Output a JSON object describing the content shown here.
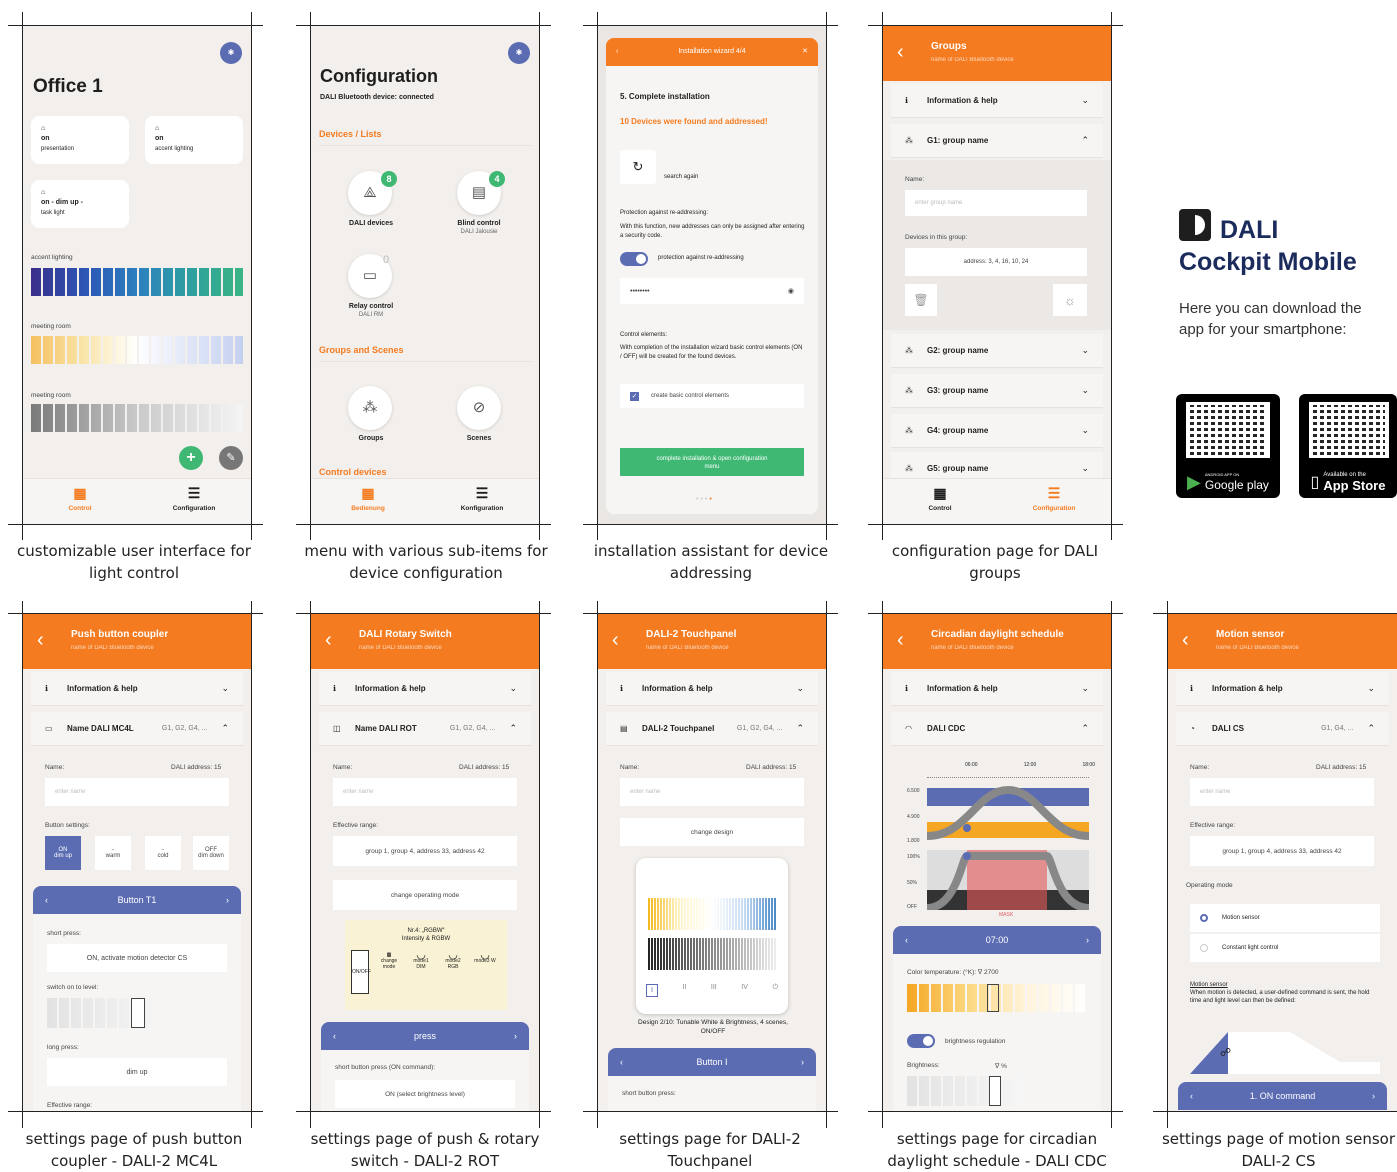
{
  "captions": [
    "customizable user interface for light control",
    "menu with various sub-items for device configuration",
    "installation assistant for device addressing",
    "configuration page for DALI groups",
    "settings page of push button coupler - DALI-2 MC4L",
    "settings page of push & rotary switch - DALI-2 ROT",
    "settings page for DALI-2 Touchpanel",
    "settings page for circadian daylight schedule - DALI CDC",
    "settings page of motion sensor DALI-2 CS"
  ],
  "promo": {
    "title_line1": "DALI",
    "title_line2": "Cockpit Mobile",
    "text": "Here you can download the app for your smartphone:",
    "google_label": "Google play",
    "google_pre": "ANDROID APP ON",
    "apple_pre": "Available on the",
    "apple_label": "App Store"
  },
  "s1": {
    "title": "Office 1",
    "tiles": [
      {
        "state": "on",
        "name": "presentation"
      },
      {
        "state": "on",
        "name": "accent lighting"
      },
      {
        "state": "on -   dim up -",
        "name": "task light"
      }
    ],
    "sliders": [
      "accent lighting",
      "meeting room",
      "meeting room"
    ],
    "nav": [
      "Control",
      "Configuration"
    ]
  },
  "s2": {
    "title": "Configuration",
    "status": "DALI Bluetooth device: connected",
    "sections": [
      "Devices / Lists",
      "Groups and Scenes",
      "Control devices"
    ],
    "items": [
      {
        "label": "DALI devices",
        "sub": "",
        "count": "8"
      },
      {
        "label": "Blind control",
        "sub": "DALI Jalousie",
        "count": "4"
      },
      {
        "label": "Relay control",
        "sub": "DALI RM",
        "count": "0"
      },
      {
        "label": "Groups",
        "sub": "",
        "count": ""
      },
      {
        "label": "Scenes",
        "sub": "",
        "count": ""
      }
    ],
    "nav": [
      "Bedienung",
      "Konfiguration"
    ]
  },
  "s3": {
    "title": "Installation wizard 4/4",
    "step": "5. Complete installation",
    "found": "10 Devices were  found and addressed!",
    "search": "search again",
    "protect_head": "Protection against re-addressing:",
    "protect_text": "With this function, new addresses can only be assigned after entering a security code.",
    "protect_toggle": "protection against re-addressing",
    "password": "••••••••",
    "control_head": "Control elements:",
    "control_text": "With completion of the installation wizard basic control elements (ON / OFF) will be created for the found devices.",
    "control_check": "create basic control elements",
    "finish": "complete installation & open configuration menu"
  },
  "s4": {
    "title": "Groups",
    "subtitle": "name of DALI Bluetooth device",
    "info": "Information & help",
    "g1": "G1: group name",
    "name_label": "Name:",
    "name_ph": "enter group name",
    "devices_label": "Devices in this group:",
    "devices": "address: 3, 4, 16, 10, 24",
    "groups": [
      "G2: group name",
      "G3: group name",
      "G4: group name",
      "G5: group name"
    ],
    "nav": [
      "Control",
      "Configuration"
    ]
  },
  "s5": {
    "title": "Push button coupler",
    "subtitle": "name of DALI Bluetooth device",
    "info": "Information & help",
    "device": "Name DALI MC4L",
    "groups": "G1, G2, G4, ...",
    "name_label": "Name:",
    "address": "DALI address: 15",
    "name_ph": "enter name",
    "btn_settings": "Button settings:",
    "buttons": [
      [
        "ON",
        "dim up"
      ],
      [
        "-",
        "warm"
      ],
      [
        "-",
        "cold"
      ],
      [
        "OFF",
        "dim down"
      ]
    ],
    "bar": "Button T1",
    "short": "short press:",
    "short_val": "ON, activate motion detector CS",
    "switch": "switch on to level:",
    "long": "long press:",
    "long_val": "dim up",
    "range": "Effective range:"
  },
  "s6": {
    "title": "DALI Rotary Switch",
    "subtitle": "name of DALI Bluetooth device",
    "info": "Information & help",
    "device": "Name DALI ROT",
    "groups": "G1, G2, G4, ...",
    "name_label": "Name:",
    "address": "DALI address: 15",
    "name_ph": "enter name",
    "range_label": "Effective range:",
    "range": "group 1, group 4, address 33, address 42",
    "mode_btn": "change operating mode",
    "mode_title": "Nr.4: „RGBW“",
    "mode_sub": "Intensity & RGBW",
    "modes": [
      "ON/OFF",
      "change mode",
      "mode1 DIM",
      "mode2 RGB",
      "mode3 W"
    ],
    "bar": "press",
    "short": "short button press (ON command):",
    "short_val": "ON (select brightness level)"
  },
  "s7": {
    "title": "DALI-2 Touchpanel",
    "subtitle": "name of DALI Bluetooth device",
    "info": "Information & help",
    "device": "DALI-2 Touchpanel",
    "groups": "G1, G2, G4, ...",
    "name_label": "Name:",
    "address": "DALI address: 15",
    "name_ph": "enter name",
    "design_btn": "change design",
    "design_text": "Design 2/10: Tunable White & Brightness, 4 scenes, ON/OFF",
    "bar": "Button  I",
    "short": "short button press:"
  },
  "s8": {
    "title": "Circadian daylight schedule",
    "subtitle": "name of DALI Bluetooth device",
    "info": "Information & help",
    "device": "DALI CDC",
    "times": [
      "06:00",
      "12:00",
      "18:00"
    ],
    "yvals": [
      "6.500",
      "4.900",
      "1.800",
      "100%",
      "50%",
      "OFF"
    ],
    "mask": "MASK",
    "bar": "07:00",
    "color_label": "Color temperature: (°K):  ∇  2700",
    "bright_toggle": "brightness regulation",
    "bright_label": "Brightness:",
    "bright_val": "∇  %"
  },
  "s9": {
    "title": "Motion sensor",
    "subtitle": "name of DALI Bluetooth device",
    "info": "Information & help",
    "device": "DALI CS",
    "groups": "G1, G4, ...",
    "name_label": "Name:",
    "address": "DALI address: 15",
    "name_ph": "enter name",
    "range_label": "Effective range:",
    "range": "group 1, group 4, address 33, address 42",
    "mode_label": "Operating mode",
    "opt1": "Motion sensor",
    "opt2": "Constant light control",
    "ms_head": "Motion sensor",
    "ms_text": "When motion is detected, a user-defined command is sent, the hold time and light level can then be defined:",
    "bar": "1. ON command"
  },
  "colors": {
    "orange": "#f47b20",
    "blue": "#5b6cb3",
    "green": "#3fb874"
  }
}
